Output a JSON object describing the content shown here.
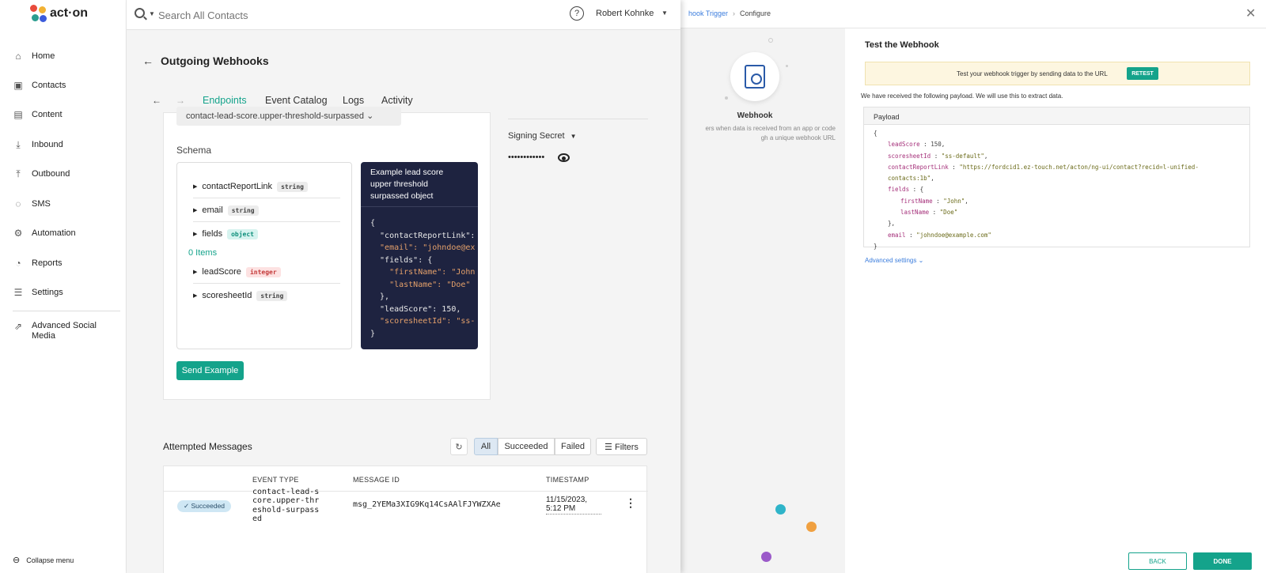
{
  "colors": {
    "accent": "#14a38b",
    "tab_active": "#14a38b",
    "status_succeeded": "#cfe7f4"
  },
  "logo": {
    "text": "act·on"
  },
  "sidebar": {
    "items": [
      {
        "label": "Home",
        "icon": "home-icon"
      },
      {
        "label": "Contacts",
        "icon": "contacts-icon"
      },
      {
        "label": "Content",
        "icon": "content-icon"
      },
      {
        "label": "Inbound",
        "icon": "inbound-icon"
      },
      {
        "label": "Outbound",
        "icon": "outbound-icon"
      },
      {
        "label": "SMS",
        "icon": "sms-icon"
      },
      {
        "label": "Automation",
        "icon": "automation-icon"
      },
      {
        "label": "Reports",
        "icon": "reports-icon"
      },
      {
        "label": "Settings",
        "icon": "settings-icon"
      }
    ],
    "extra": {
      "label": "Advanced Social Media",
      "icon": "external-link-icon"
    },
    "collapse": "Collapse menu"
  },
  "topbar": {
    "search_placeholder": "Search All Contacts",
    "user": "Robert Kohnke"
  },
  "page": {
    "title": "Outgoing Webhooks"
  },
  "tabs": [
    "Endpoints",
    "Event Catalog",
    "Logs",
    "Activity"
  ],
  "endpoint": {
    "event_select": "contact-lead-score.upper-threshold-surpassed",
    "schema_label": "Schema",
    "fields": [
      {
        "name": "contactReportLink",
        "type": "string"
      },
      {
        "name": "email",
        "type": "string"
      },
      {
        "name": "fields",
        "type": "object"
      },
      {
        "name": "leadScore",
        "type": "integer"
      },
      {
        "name": "scoresheetId",
        "type": "string"
      }
    ],
    "items_label": "0 Items",
    "example_title": "Example lead score upper threshold surpassed object",
    "example_code": [
      "{",
      "  \"contactReportLink\": ",
      "  \"email\": \"johndoe@ex",
      "  \"fields\": {",
      "    \"firstName\": \"John",
      "    \"lastName\": \"Doe\"",
      "  },",
      "  \"leadScore\": 150,",
      "  \"scoresheetId\": \"ss-",
      "}"
    ],
    "send_example": "Send Example",
    "signing_secret_label": "Signing Secret",
    "signing_secret_value": "••••••••••••"
  },
  "attempted": {
    "title": "Attempted Messages",
    "filters": [
      "All",
      "Succeeded",
      "Failed"
    ],
    "filters_button": "Filters",
    "columns": [
      "EVENT TYPE",
      "MESSAGE ID",
      "TIMESTAMP"
    ],
    "rows": [
      {
        "status": "Succeeded",
        "event_type": "contact-lead-score.upper-threshold-surpassed",
        "message_id": "msg_2YEMa3XIG9Kq14CsAAlFJYWZXAe",
        "timestamp": "11/15/2023, 5:12 PM"
      }
    ]
  },
  "webhook_panel": {
    "breadcrumb": [
      "hook Trigger",
      "Configure"
    ],
    "node_title": "Webhook",
    "node_desc": "ers when data is received from an app or code\ngh a unique webhook URL",
    "test_title": "Test the Webhook",
    "banner_text": "Test your webhook trigger by sending data to the URL",
    "retest": "RETEST",
    "received": "We have received the following payload. We will use this to extract data.",
    "payload_label": "Payload",
    "payload": {
      "leadScore": "150",
      "scoresheetId": "\"ss-default\"",
      "contactReportLink": "\"https://fordcid1.ez-touch.net/acton/ng-ui/contact?recid=l-unified-contacts:1b\"",
      "firstName": "\"John\"",
      "lastName": "\"Doe\"",
      "email": "\"johndoe@example.com\""
    },
    "advanced": "Advanced settings",
    "back": "BACK",
    "done": "DONE"
  }
}
